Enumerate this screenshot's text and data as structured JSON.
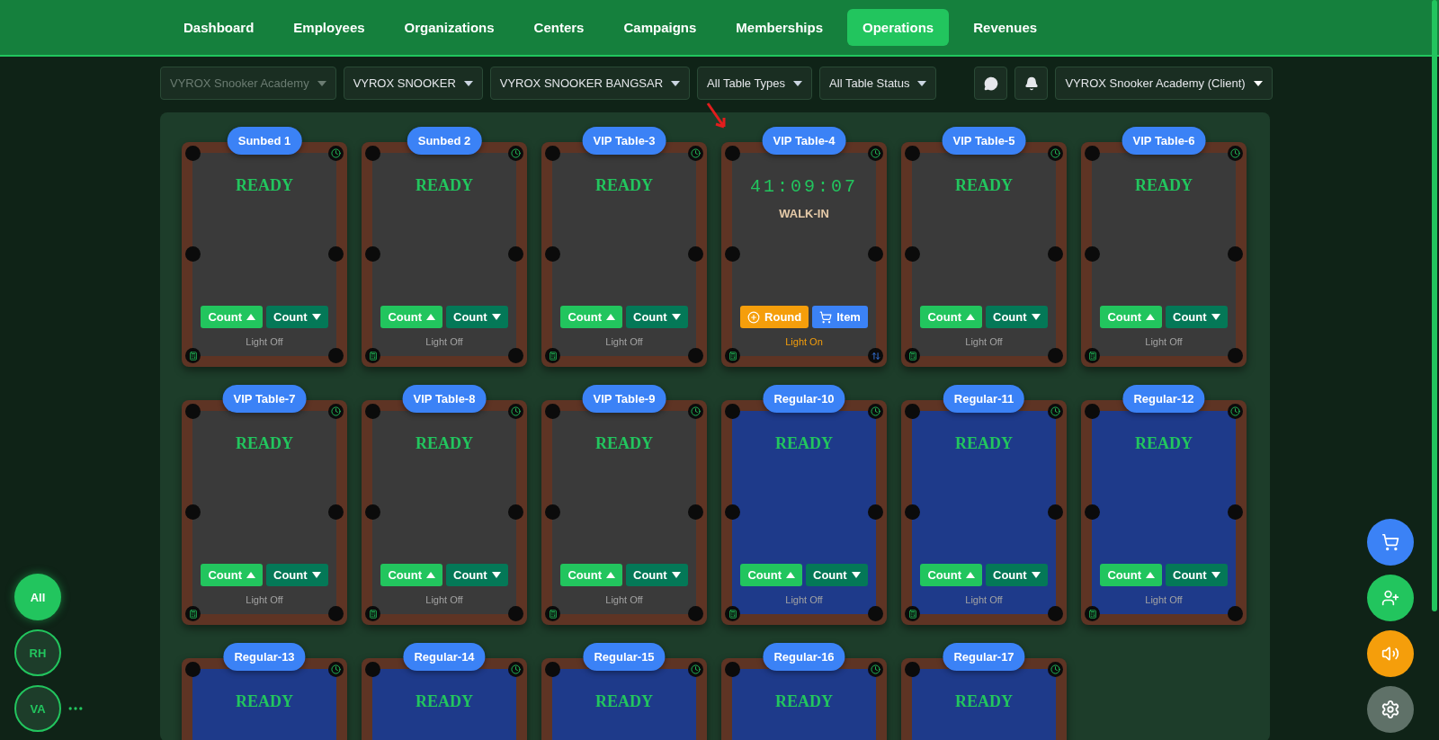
{
  "nav": {
    "tabs": [
      {
        "label": "Dashboard",
        "selected": false
      },
      {
        "label": "Employees",
        "selected": false
      },
      {
        "label": "Organizations",
        "selected": false
      },
      {
        "label": "Centers",
        "selected": false
      },
      {
        "label": "Campaigns",
        "selected": false
      },
      {
        "label": "Memberships",
        "selected": false
      },
      {
        "label": "Operations",
        "selected": true
      },
      {
        "label": "Revenues",
        "selected": false
      }
    ]
  },
  "filters": [
    {
      "label": "VYROX Snooker Academy",
      "disabled": true
    },
    {
      "label": "VYROX SNOOKER",
      "disabled": false
    },
    {
      "label": "VYROX SNOOKER BANGSAR",
      "disabled": false
    },
    {
      "label": "All Table Types",
      "disabled": false
    },
    {
      "label": "All Table Status",
      "disabled": false
    }
  ],
  "account": {
    "label": "VYROX Snooker Academy (Client)"
  },
  "tables": [
    {
      "label": "Sunbed 1",
      "color": "#3a3a3a",
      "kind": "ready",
      "status_text": "READY",
      "buttons": [
        {
          "kind": "count-up",
          "label": "Count"
        },
        {
          "kind": "count-down",
          "label": "Count"
        }
      ],
      "light": "Light Off",
      "light_on": false
    },
    {
      "label": "Sunbed 2",
      "color": "#3a3a3a",
      "kind": "ready",
      "status_text": "READY",
      "buttons": [
        {
          "kind": "count-up",
          "label": "Count"
        },
        {
          "kind": "count-down",
          "label": "Count"
        }
      ],
      "light": "Light Off",
      "light_on": false
    },
    {
      "label": "VIP Table-3",
      "color": "#3a3a3a",
      "kind": "ready",
      "status_text": "READY",
      "buttons": [
        {
          "kind": "count-up",
          "label": "Count"
        },
        {
          "kind": "count-down",
          "label": "Count"
        }
      ],
      "light": "Light Off",
      "light_on": false
    },
    {
      "label": "VIP Table-4",
      "color": "#3a3a3a",
      "kind": "running",
      "status_text": "41:09:07",
      "session": "WALK-IN",
      "buttons": [
        {
          "kind": "round",
          "label": "Round"
        },
        {
          "kind": "item",
          "label": "Item"
        }
      ],
      "light": "Light On",
      "light_on": true,
      "swap": true
    },
    {
      "label": "VIP Table-5",
      "color": "#3a3a3a",
      "kind": "ready",
      "status_text": "READY",
      "buttons": [
        {
          "kind": "count-up",
          "label": "Count"
        },
        {
          "kind": "count-down",
          "label": "Count"
        }
      ],
      "light": "Light Off",
      "light_on": false
    },
    {
      "label": "VIP Table-6",
      "color": "#3a3a3a",
      "kind": "ready",
      "status_text": "READY",
      "buttons": [
        {
          "kind": "count-up",
          "label": "Count"
        },
        {
          "kind": "count-down",
          "label": "Count"
        }
      ],
      "light": "Light Off",
      "light_on": false
    },
    {
      "label": "VIP Table-7",
      "color": "#3a3a3a",
      "kind": "ready",
      "status_text": "READY",
      "buttons": [
        {
          "kind": "count-up",
          "label": "Count"
        },
        {
          "kind": "count-down",
          "label": "Count"
        }
      ],
      "light": "Light Off",
      "light_on": false
    },
    {
      "label": "VIP Table-8",
      "color": "#3a3a3a",
      "kind": "ready",
      "status_text": "READY",
      "buttons": [
        {
          "kind": "count-up",
          "label": "Count"
        },
        {
          "kind": "count-down",
          "label": "Count"
        }
      ],
      "light": "Light Off",
      "light_on": false
    },
    {
      "label": "VIP Table-9",
      "color": "#3a3a3a",
      "kind": "ready",
      "status_text": "READY",
      "buttons": [
        {
          "kind": "count-up",
          "label": "Count"
        },
        {
          "kind": "count-down",
          "label": "Count"
        }
      ],
      "light": "Light Off",
      "light_on": false
    },
    {
      "label": "Regular-10",
      "color": "#1e3a8a",
      "kind": "ready",
      "status_text": "READY",
      "buttons": [
        {
          "kind": "count-up",
          "label": "Count"
        },
        {
          "kind": "count-down",
          "label": "Count"
        }
      ],
      "light": "Light Off",
      "light_on": false
    },
    {
      "label": "Regular-11",
      "color": "#1e3a8a",
      "kind": "ready",
      "status_text": "READY",
      "buttons": [
        {
          "kind": "count-up",
          "label": "Count"
        },
        {
          "kind": "count-down",
          "label": "Count"
        }
      ],
      "light": "Light Off",
      "light_on": false
    },
    {
      "label": "Regular-12",
      "color": "#1e3a8a",
      "kind": "ready",
      "status_text": "READY",
      "buttons": [
        {
          "kind": "count-up",
          "label": "Count"
        },
        {
          "kind": "count-down",
          "label": "Count"
        }
      ],
      "light": "Light Off",
      "light_on": false
    },
    {
      "label": "Regular-13",
      "color": "#1e3a8a",
      "kind": "ready",
      "status_text": "READY"
    },
    {
      "label": "Regular-14",
      "color": "#1e3a8a",
      "kind": "ready",
      "status_text": "READY"
    },
    {
      "label": "Regular-15",
      "color": "#1e3a8a",
      "kind": "ready",
      "status_text": "READY"
    },
    {
      "label": "Regular-16",
      "color": "#1e3a8a",
      "kind": "ready",
      "status_text": "READY"
    },
    {
      "label": "Regular-17",
      "color": "#1e3a8a",
      "kind": "ready",
      "status_text": "READY"
    }
  ],
  "staff_filters": [
    {
      "label": "All",
      "selected": true
    },
    {
      "label": "RH",
      "selected": false
    },
    {
      "label": "VA",
      "selected": false
    }
  ]
}
